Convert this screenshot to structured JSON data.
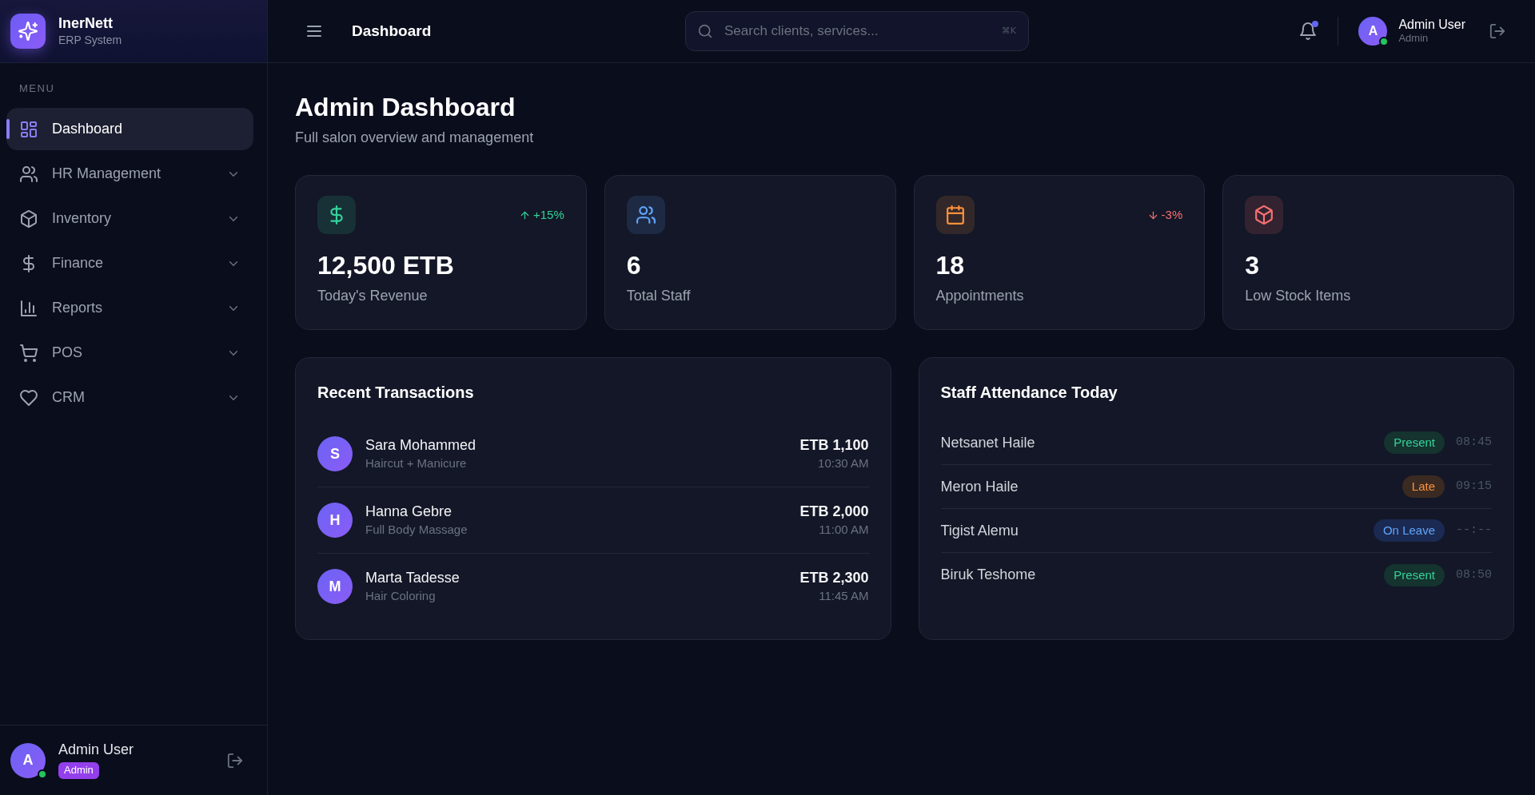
{
  "brand": {
    "name": "InerNett",
    "tagline": "ERP System"
  },
  "sidebar": {
    "heading": "MENU",
    "items": [
      {
        "label": "Dashboard",
        "kind": "link",
        "selected": true
      },
      {
        "label": "HR Management",
        "kind": "group",
        "selected": false,
        "expanded": false
      },
      {
        "label": "Inventory",
        "kind": "group",
        "selected": false,
        "expanded": false
      },
      {
        "label": "Finance",
        "kind": "group",
        "selected": false,
        "expanded": false
      },
      {
        "label": "Reports",
        "kind": "group",
        "selected": false,
        "expanded": false
      },
      {
        "label": "POS",
        "kind": "group",
        "selected": false,
        "expanded": false
      },
      {
        "label": "CRM",
        "kind": "group",
        "selected": false,
        "expanded": false
      }
    ]
  },
  "sidebar_user": {
    "initial": "A",
    "name": "Admin User",
    "role": "Admin",
    "online": true
  },
  "header": {
    "title": "Dashboard",
    "search": {
      "placeholder": "Search clients, services...",
      "shortcut": "⌘K"
    },
    "notifications": {
      "unread": true
    },
    "user": {
      "initial": "A",
      "name": "Admin User",
      "role": "Admin",
      "online": true
    }
  },
  "page": {
    "title": "Admin Dashboard",
    "subtitle": "Full salon overview and management"
  },
  "stats": [
    {
      "color": "#34d399",
      "value": "12,500 ETB",
      "label": "Today's Revenue",
      "trend": {
        "kind": "up",
        "text": "+15%"
      }
    },
    {
      "color": "#60a5fa",
      "value": "6",
      "label": "Total Staff"
    },
    {
      "color": "#fb923c",
      "value": "18",
      "label": "Appointments",
      "trend": {
        "kind": "down",
        "text": "-3%"
      }
    },
    {
      "color": "#f87171",
      "value": "3",
      "label": "Low Stock Items"
    }
  ],
  "recent_transactions": {
    "title": "Recent Transactions",
    "rows": [
      {
        "initial": "S",
        "name": "Sara Mohammed",
        "service": "Haircut + Manicure",
        "amount": "ETB 1,100",
        "time": "10:30 AM"
      },
      {
        "initial": "H",
        "name": "Hanna Gebre",
        "service": "Full Body Massage",
        "amount": "ETB 2,000",
        "time": "11:00 AM"
      },
      {
        "initial": "M",
        "name": "Marta Tadesse",
        "service": "Hair Coloring",
        "amount": "ETB 2,300",
        "time": "11:45 AM"
      }
    ]
  },
  "staff_attendance": {
    "title": "Staff Attendance Today",
    "rows": [
      {
        "name": "Netsanet Haile",
        "status": "Present",
        "kind": "present",
        "time": "08:45"
      },
      {
        "name": "Meron Haile",
        "status": "Late",
        "kind": "late",
        "time": "09:15"
      },
      {
        "name": "Tigist Alemu",
        "status": "On Leave",
        "kind": "leave",
        "time": "--:--"
      },
      {
        "name": "Biruk Teshome",
        "status": "Present",
        "kind": "present",
        "time": "08:50"
      }
    ]
  }
}
